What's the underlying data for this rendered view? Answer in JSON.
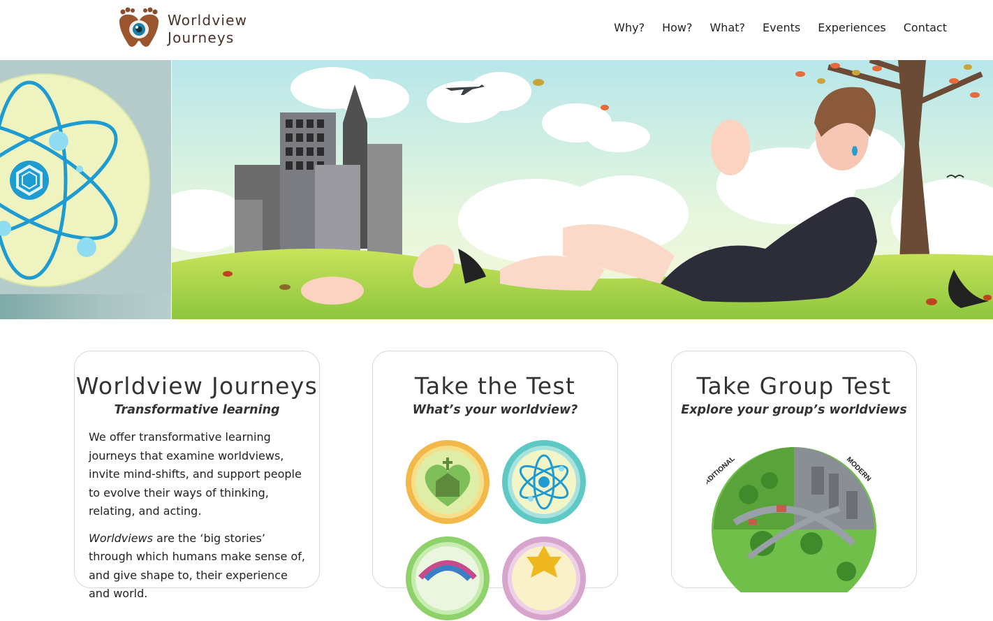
{
  "site": {
    "logo_line1": "Worldview",
    "logo_line2": "Journeys"
  },
  "nav": {
    "items": [
      "Why?",
      "How?",
      "What?",
      "Events",
      "Experiences",
      "Contact"
    ]
  },
  "cards": [
    {
      "title": "Worldview Journeys",
      "subtitle": "Transformative learning",
      "para1": "We offer transformative learning journeys that examine worldviews, invite mind-shifts, and support people to evolve their ways of thinking, relating, and acting.",
      "para2_em": "Worldviews",
      "para2_rest": " are the ‘big stories’ through which humans make sense of, and give shape to, their experience and world."
    },
    {
      "title": "Take the Test",
      "subtitle": "What’s your worldview?"
    },
    {
      "title": "Take Group Test",
      "subtitle": "Explore your group’s worldviews",
      "globe_label_left": "TRADITIONAL",
      "globe_label_right": "MODERN"
    }
  ],
  "colors": {
    "logo_brown": "#4a3226",
    "eye_blue": "#1b7fa8",
    "text_dark": "#333333",
    "card_border": "#d8d8d8"
  },
  "icons": {
    "logo": "footprints-eye-icon",
    "badge1": "heart-church-icon",
    "badge2": "atom-icon",
    "badge3": "earth-arc-icon",
    "badge4": "star-flower-icon"
  }
}
